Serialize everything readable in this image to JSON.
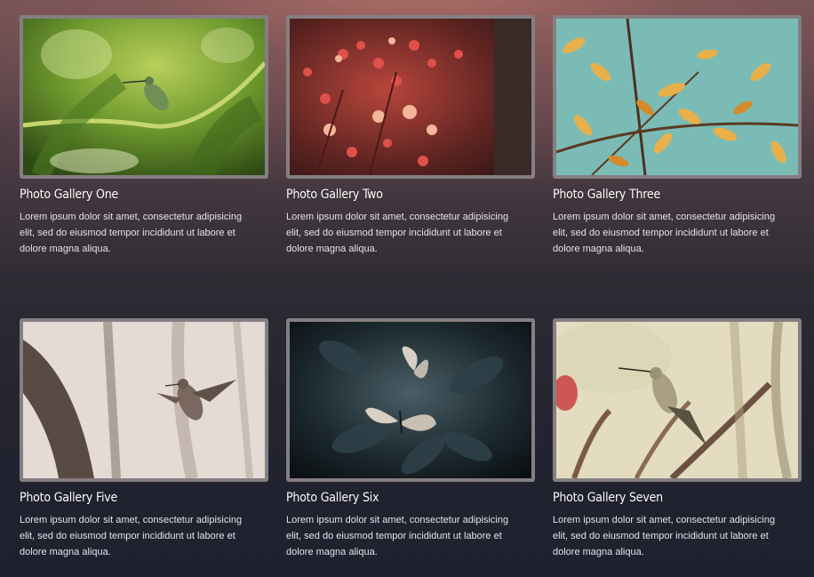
{
  "galleries": [
    {
      "title": "Photo Gallery One",
      "description": "Lorem ipsum dolor sit amet, consectetur adipisicing elit, sed do eiusmod tempor incididunt ut labore et dolore magna aliqua.",
      "image": "hummingbird-on-green-branch"
    },
    {
      "title": "Photo Gallery Two",
      "description": "Lorem ipsum dolor sit amet, consectetur adipisicing elit, sed do eiusmod tempor incididunt ut labore et dolore magna aliqua.",
      "image": "red-flower-blossoms"
    },
    {
      "title": "Photo Gallery Three",
      "description": "Lorem ipsum dolor sit amet, consectetur adipisicing elit, sed do eiusmod tempor incididunt ut labore et dolore magna aliqua.",
      "image": "yellow-autumn-leaves-blue-sky"
    },
    {
      "title": "Photo Gallery Five",
      "description": "Lorem ipsum dolor sit amet, consectetur adipisicing elit, sed do eiusmod tempor incididunt ut labore et dolore magna aliqua.",
      "image": "hummingbird-in-flight-sepia"
    },
    {
      "title": "Photo Gallery Six",
      "description": "Lorem ipsum dolor sit amet, consectetur adipisicing elit, sed do eiusmod tempor incididunt ut labore et dolore magna aliqua.",
      "image": "butterflies-dark-foliage"
    },
    {
      "title": "Photo Gallery Seven",
      "description": "Lorem ipsum dolor sit amet, consectetur adipisicing elit, sed do eiusmod tempor incididunt ut labore et dolore magna aliqua.",
      "image": "hummingbird-perched-branch"
    }
  ],
  "colors": {
    "title_text": "#ffffff",
    "body_text": "#e6e2e6",
    "thumb_border": "#c8bec3"
  }
}
